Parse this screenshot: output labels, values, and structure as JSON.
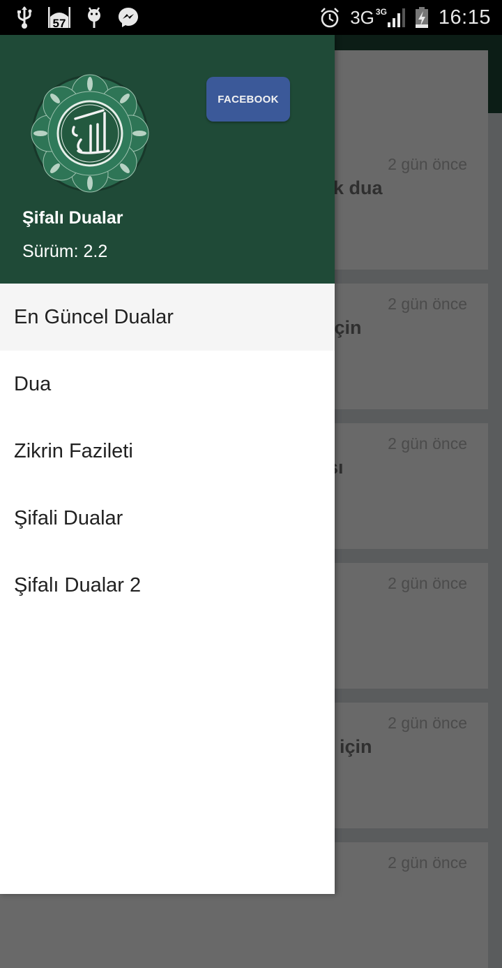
{
  "status_bar": {
    "left_icons": [
      "usb-icon",
      "prayer-time-icon",
      "android-debug-icon",
      "messenger-icon"
    ],
    "prayer_badge": "57",
    "right_icons": [
      "alarm-icon",
      "network-3g-icon",
      "signal-icon",
      "battery-charging-icon"
    ],
    "network_label": "3G",
    "network_sup": "3G",
    "time": "16:15"
  },
  "toolbar": {
    "search_icon": "search-icon"
  },
  "feed": {
    "cards": [
      {
        "time": "",
        "title": ""
      },
      {
        "time": "2 gün önce",
        "title": "k dua"
      },
      {
        "time": "2 gün önce",
        "title": "için"
      },
      {
        "time": "2 gün önce",
        "title": "sı"
      },
      {
        "time": "2 gün önce",
        "title": ""
      },
      {
        "time": "2 gün önce",
        "title": "için"
      },
      {
        "time": "2 gün önce",
        "title": ""
      }
    ]
  },
  "drawer": {
    "header": {
      "logo": "allah-calligraphy-emblem",
      "facebook_label": "FACEBOOK",
      "app_name": "Şifalı Dualar",
      "version": "Sürüm: 2.2",
      "background": "#1f4a37",
      "facebook_color": "#3b5999"
    },
    "menu": [
      {
        "label": "En Güncel Dualar",
        "active": true
      },
      {
        "label": "Dua",
        "active": false
      },
      {
        "label": "Zikrin Fazileti",
        "active": false
      },
      {
        "label": "Şifali Dualar",
        "active": false
      },
      {
        "label": "Şifalı Dualar 2",
        "active": false
      }
    ]
  }
}
